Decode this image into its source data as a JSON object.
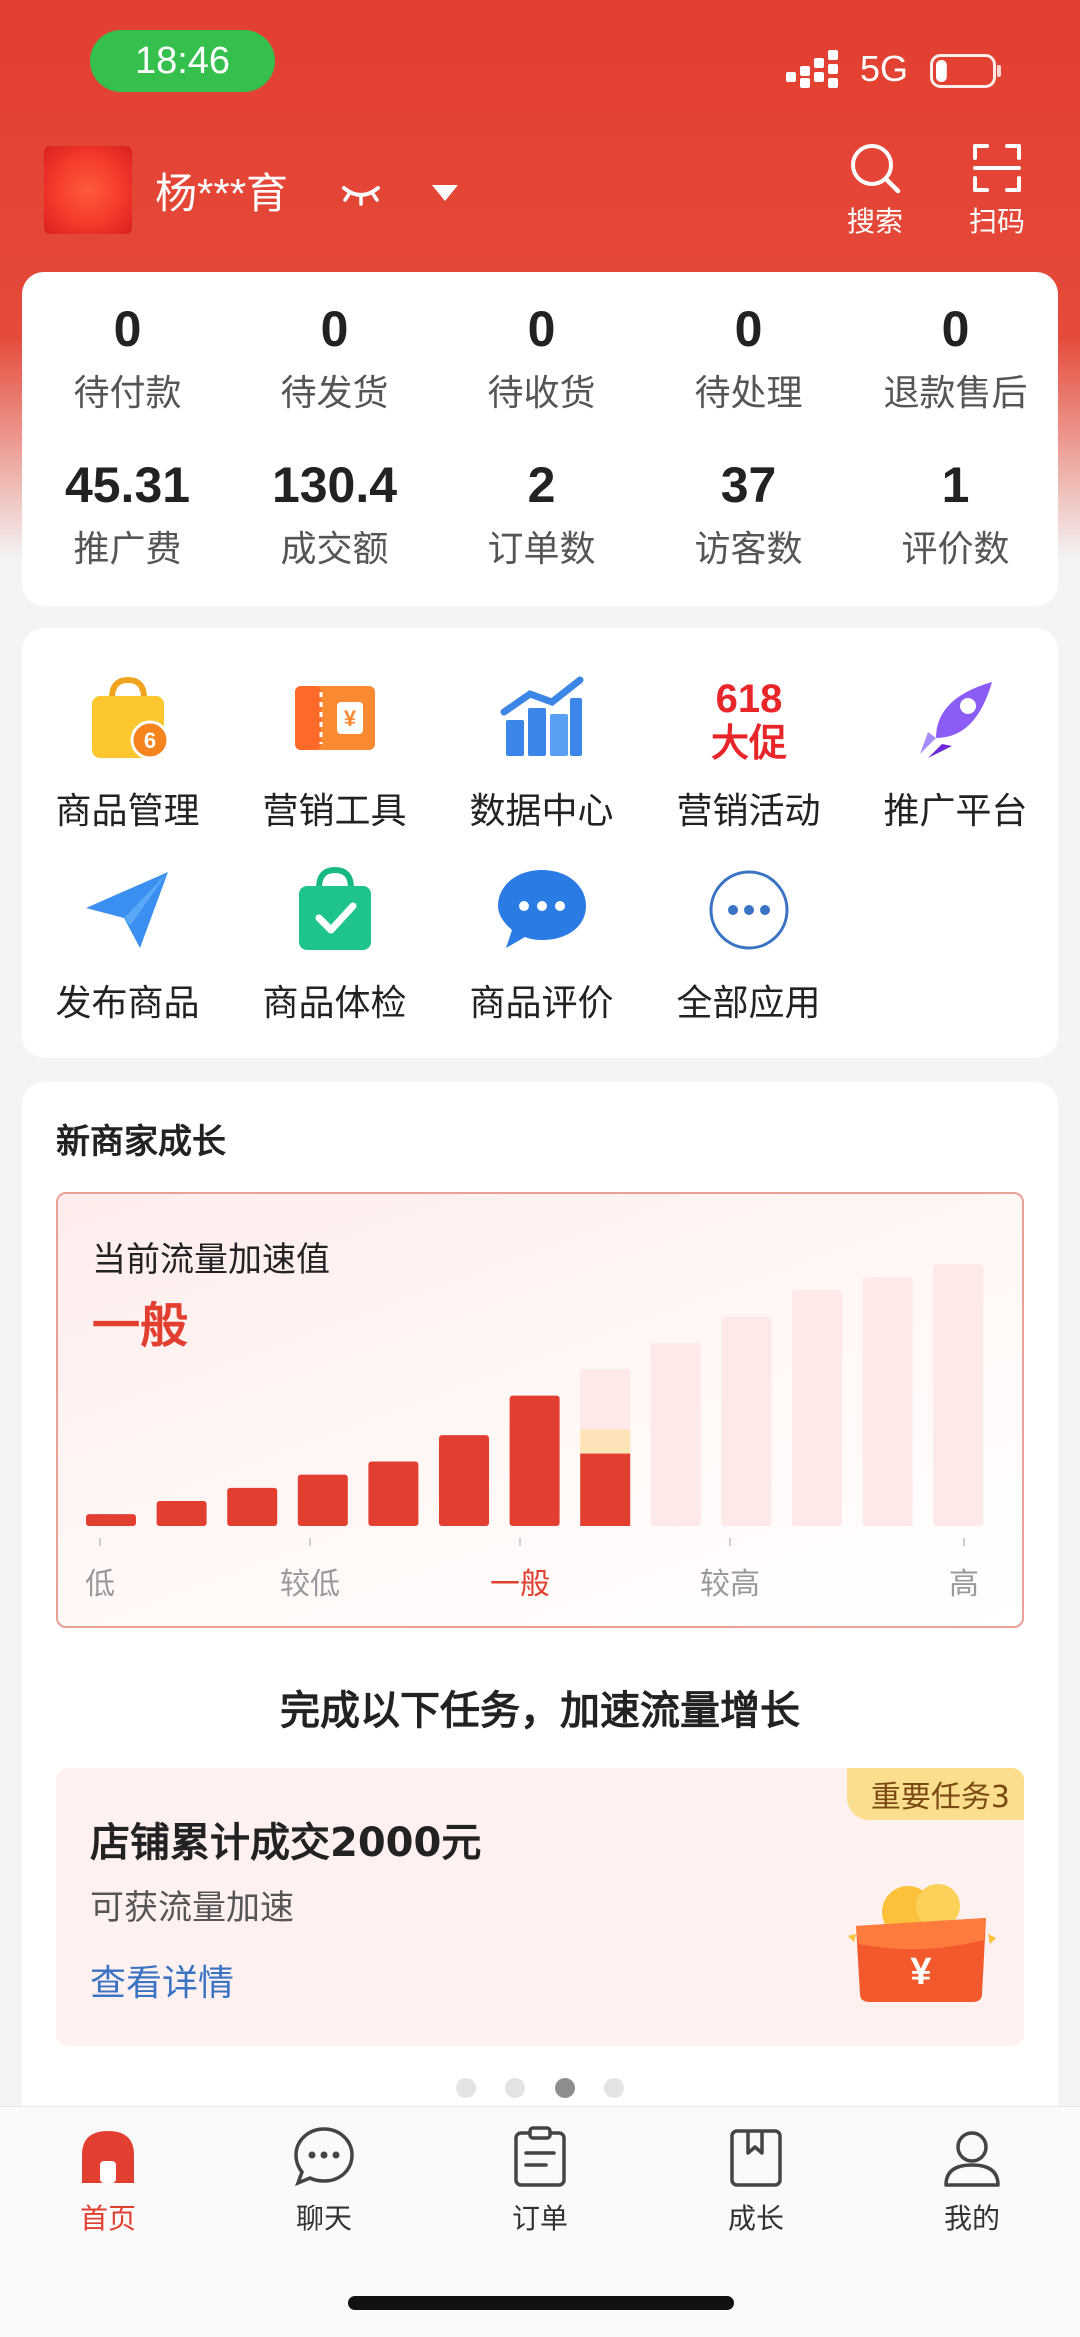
{
  "status_bar": {
    "time": "18:46",
    "network": "5G",
    "battery_level": 0.2
  },
  "header": {
    "shop_name": "杨***育",
    "search_label": "搜索",
    "scan_label": "扫码"
  },
  "stats": {
    "orders": [
      {
        "value": "0",
        "label": "待付款"
      },
      {
        "value": "0",
        "label": "待发货"
      },
      {
        "value": "0",
        "label": "待收货"
      },
      {
        "value": "0",
        "label": "待处理"
      },
      {
        "value": "0",
        "label": "退款售后"
      }
    ],
    "metrics": [
      {
        "value": "45.31",
        "label": "推广费"
      },
      {
        "value": "130.4",
        "label": "成交额"
      },
      {
        "value": "2",
        "label": "订单数"
      },
      {
        "value": "37",
        "label": "访客数"
      },
      {
        "value": "1",
        "label": "评价数"
      }
    ]
  },
  "apps": [
    {
      "label": "商品管理",
      "icon": "shopping-bag-icon",
      "badge": "6"
    },
    {
      "label": "营销工具",
      "icon": "coupon-ticket-icon"
    },
    {
      "label": "数据中心",
      "icon": "data-chart-icon"
    },
    {
      "label": "营销活动",
      "icon": "promo-618-icon",
      "icon_text_top": "618",
      "icon_text_bottom": "大促"
    },
    {
      "label": "推广平台",
      "icon": "rocket-icon"
    },
    {
      "label": "发布商品",
      "icon": "paper-plane-icon"
    },
    {
      "label": "商品体检",
      "icon": "checked-bag-icon"
    },
    {
      "label": "商品评价",
      "icon": "chat-bubble-icon"
    },
    {
      "label": "全部应用",
      "icon": "more-dots-icon"
    }
  ],
  "growth": {
    "title": "新商家成长",
    "chart_caption": "当前流量加速值",
    "current_level": "一般",
    "task_headline": "完成以下任务，加速流量增长",
    "task": {
      "badge": "重要任务3",
      "title": "店铺累计成交2000元",
      "subtitle": "可获流量加速",
      "link": "查看详情"
    },
    "pagination": {
      "count": 4,
      "active": 3
    }
  },
  "chart_data": {
    "type": "bar",
    "categories": [
      "低",
      "较低",
      "一般",
      "较高",
      "高"
    ],
    "bars": [
      {
        "value": 9,
        "status": "achieved"
      },
      {
        "value": 19,
        "status": "achieved"
      },
      {
        "value": 29,
        "status": "achieved"
      },
      {
        "value": 39,
        "status": "achieved"
      },
      {
        "value": 49,
        "status": "achieved"
      },
      {
        "value": 69,
        "status": "achieved"
      },
      {
        "value": 99,
        "status": "achieved"
      },
      {
        "value": 119,
        "status": "partial",
        "filled": 55
      },
      {
        "value": 139,
        "status": "locked"
      },
      {
        "value": 159,
        "status": "locked"
      },
      {
        "value": 179,
        "status": "locked"
      },
      {
        "value": 189,
        "status": "locked"
      },
      {
        "value": 199,
        "status": "locked"
      }
    ],
    "current_category": "一般",
    "colors": {
      "achieved": "#e23f31",
      "locked": "#fde9e7",
      "partial_top": "#fde0d6",
      "accent": "#e23f31"
    }
  },
  "tabbar": [
    {
      "label": "首页",
      "icon": "home-icon",
      "active": true
    },
    {
      "label": "聊天",
      "icon": "chat-icon",
      "active": false
    },
    {
      "label": "订单",
      "icon": "order-icon",
      "active": false
    },
    {
      "label": "成长",
      "icon": "growth-book-icon",
      "active": false
    },
    {
      "label": "我的",
      "icon": "profile-icon",
      "active": false
    }
  ]
}
